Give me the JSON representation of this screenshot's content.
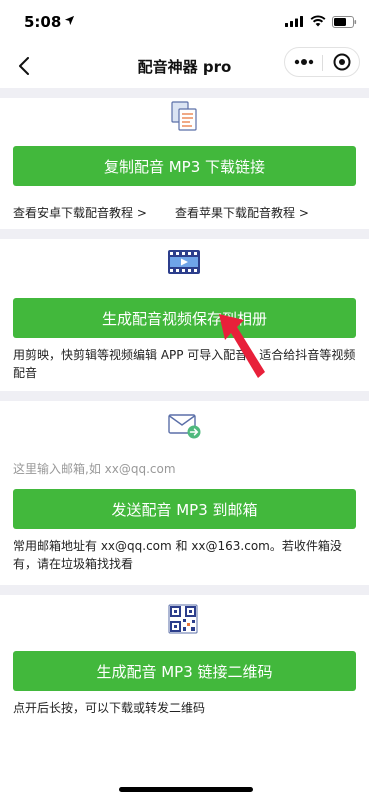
{
  "status_bar": {
    "time": "5:08"
  },
  "nav": {
    "title": "配音神器 pro"
  },
  "copy_section": {
    "button_label": "复制配音 MP3 下载链接",
    "android_link": "查看安卓下载配音教程 >",
    "ios_link": "查看苹果下载配音教程 >"
  },
  "video_section": {
    "button_label": "生成配音视频保存到相册",
    "note": "用剪映，快剪辑等视频编辑 APP 可导入配音，适合给抖音等视频配音"
  },
  "email_section": {
    "input_placeholder": "这里输入邮箱,如 xx@qq.com",
    "input_value": "",
    "button_label": "发送配音 MP3 到邮箱",
    "note": "常用邮箱地址有 xx@qq.com 和 xx@163.com。若收件箱没有，请在垃圾箱找找看"
  },
  "qr_section": {
    "button_label": "生成配音 MP3 链接二维码",
    "note": "点开后长按，可以下载或转发二维码"
  },
  "colors": {
    "primary_green": "#42b83c",
    "divider_gray": "#efeff4",
    "arrow_red": "#e8203a"
  },
  "icons": {
    "status": [
      "location-arrow-icon",
      "signal-icon",
      "wifi-icon",
      "battery-icon"
    ],
    "nav": [
      "back-chevron-icon",
      "more-dots-icon",
      "close-circle-icon"
    ],
    "sections": [
      "documents-icon",
      "film-strip-icon",
      "mail-send-icon",
      "qr-code-icon"
    ]
  }
}
